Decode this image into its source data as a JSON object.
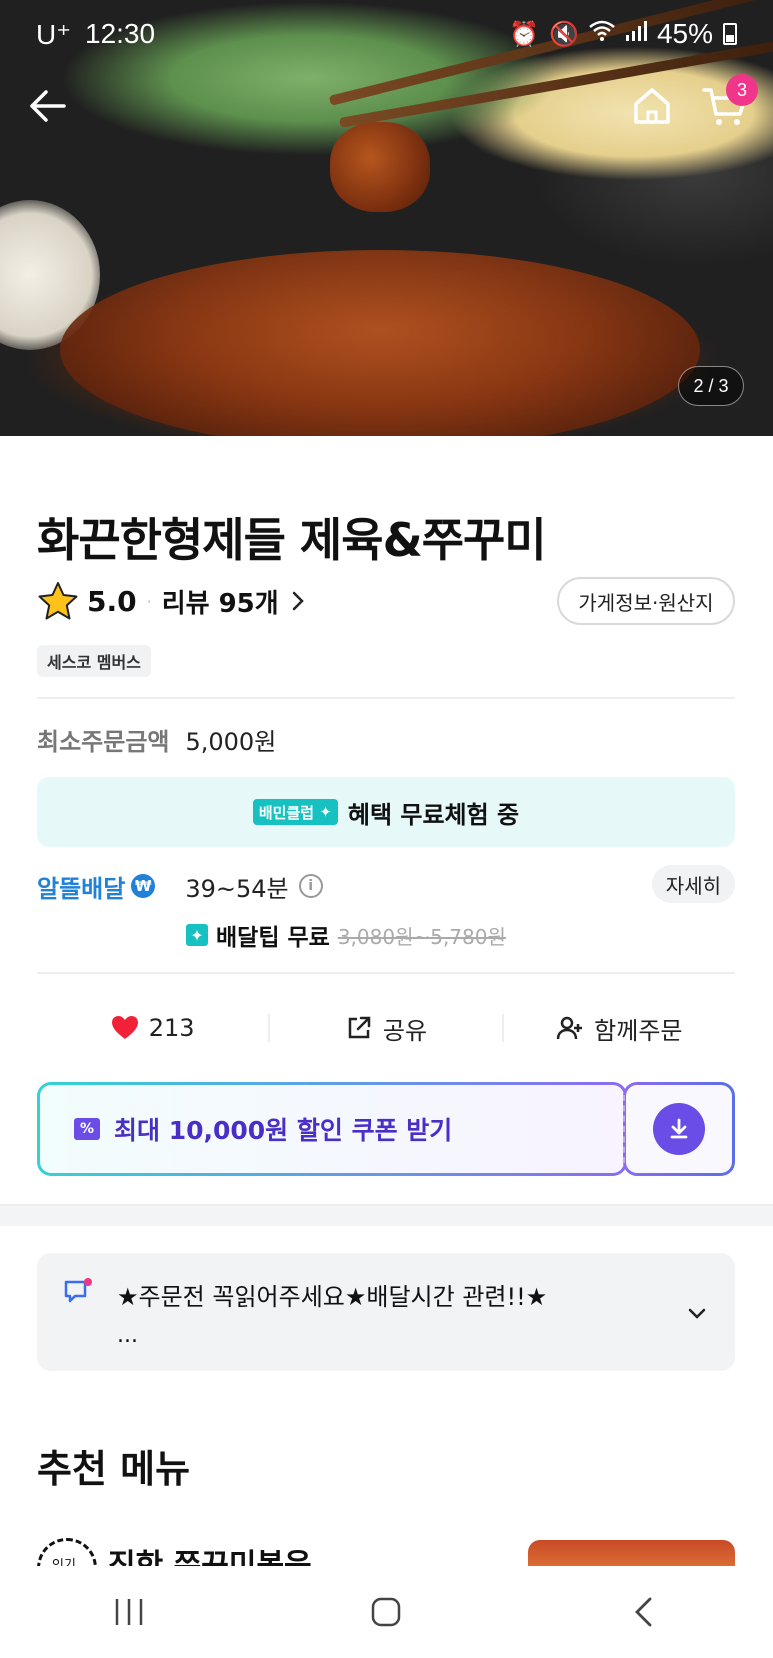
{
  "status_bar": {
    "carrier": "U⁺",
    "time": "12:30",
    "battery": "45%"
  },
  "hero": {
    "cart_count": "3",
    "image_counter": "2 / 3"
  },
  "store": {
    "name": "화끈한형제들 제육&쭈꾸미",
    "rating": "5.0",
    "review_label": "리뷰 95개",
    "info_button": "가게정보·원산지",
    "tag": "세스코 멤버스",
    "min_order_label": "최소주문금액",
    "min_order_value": "5,000원"
  },
  "baemin_club": {
    "badge": "배민클럽",
    "text": "혜택 무료체험 중",
    "accent": "#17c1c1"
  },
  "delivery": {
    "type": "알뜰배달",
    "time": "39~54분",
    "detail_button": "자세히",
    "tip_label": "배달팁 무료",
    "tip_original": "3,080원~5,780원",
    "accent": "#1f82d8"
  },
  "actions": {
    "likes": "213",
    "share": "공유",
    "group_order": "함께주문"
  },
  "coupon": {
    "text": "최대 10,000원 할인 쿠폰 받기",
    "accent": "#6a4de6"
  },
  "notice": {
    "text": "★주문전 꼭읽어주세요★배달시간 관련!!★",
    "ellipsis": "..."
  },
  "recommended": {
    "title": "추천 메뉴",
    "badge": "인기",
    "first_item": "진한 쭈꾸미볶음"
  },
  "icons": {
    "back": "back-arrow-icon",
    "home": "home-icon",
    "cart": "cart-icon",
    "star": "star-icon",
    "heart": "heart-icon",
    "share": "share-icon",
    "group": "person-add-icon",
    "download": "download-icon",
    "notice": "chat-notice-icon"
  }
}
